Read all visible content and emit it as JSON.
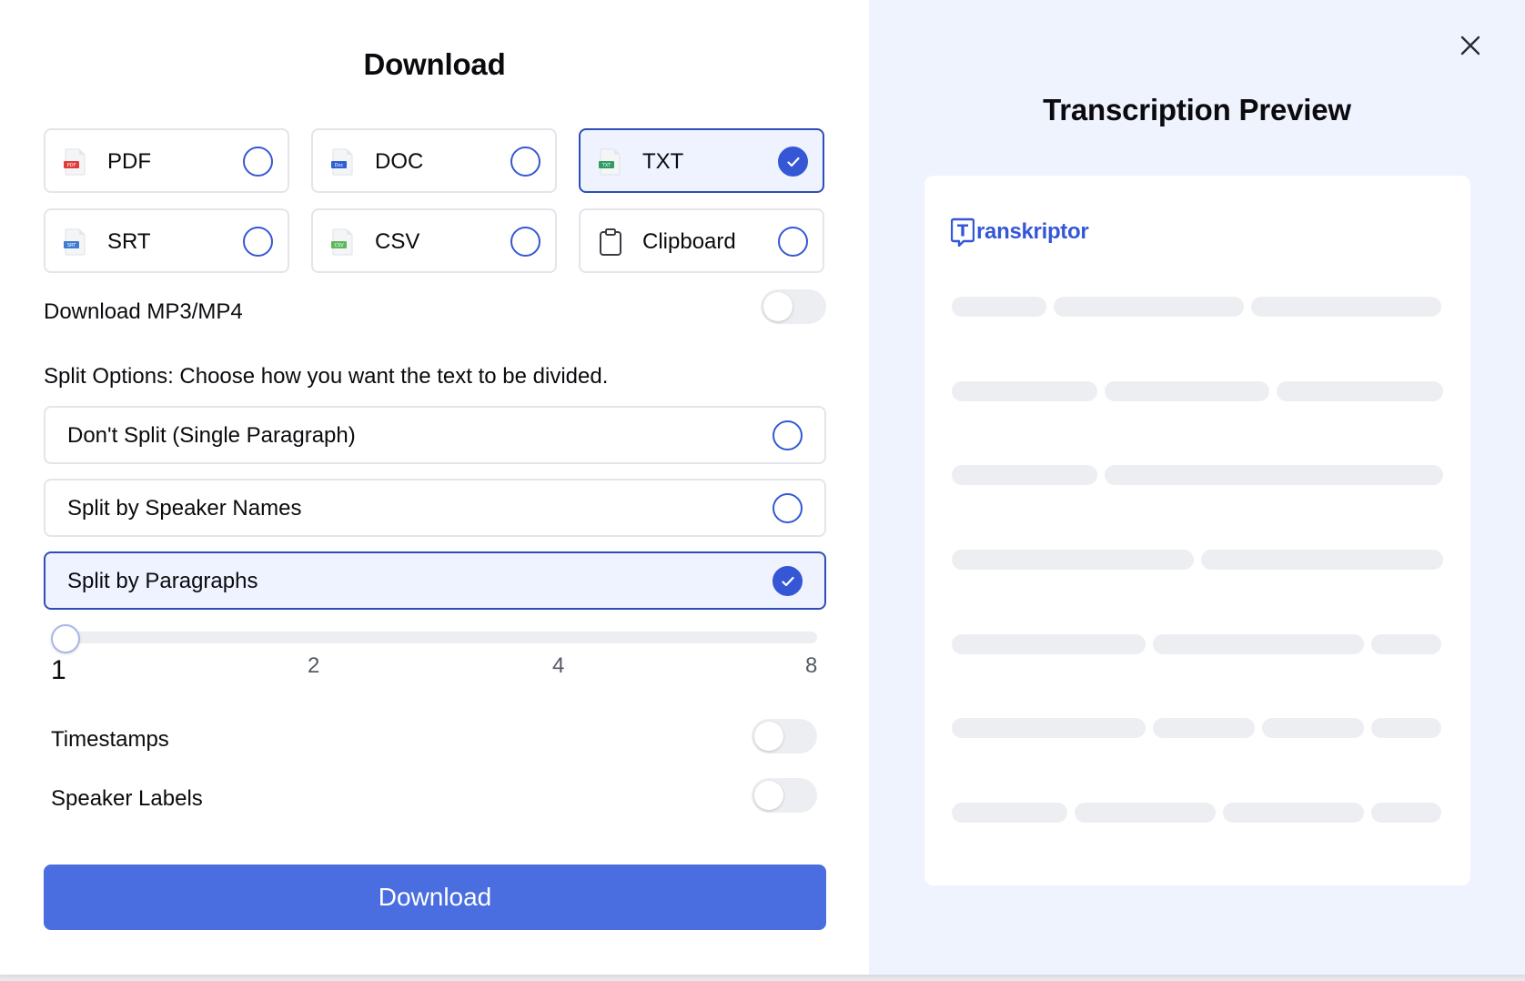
{
  "dialog": {
    "title": "Download",
    "close_icon": "close-icon"
  },
  "formats": [
    {
      "id": "pdf",
      "label": "PDF",
      "icon": "pdf-file-icon",
      "badge": "PDF",
      "color": "#e23b3b",
      "selected": false
    },
    {
      "id": "doc",
      "label": "DOC",
      "icon": "doc-file-icon",
      "badge": "Doc",
      "color": "#2f5fd0",
      "selected": false
    },
    {
      "id": "txt",
      "label": "TXT",
      "icon": "txt-file-icon",
      "badge": "TXT",
      "color": "#2f9d63",
      "selected": true
    },
    {
      "id": "srt",
      "label": "SRT",
      "icon": "srt-file-icon",
      "badge": "SRT",
      "color": "#3f7bd1",
      "selected": false
    },
    {
      "id": "csv",
      "label": "CSV",
      "icon": "csv-file-icon",
      "badge": "CSV",
      "color": "#5cb85c",
      "selected": false
    },
    {
      "id": "clipboard",
      "label": "Clipboard",
      "icon": "clipboard-icon",
      "selected": false
    }
  ],
  "media_download": {
    "label": "Download MP3/MP4",
    "enabled": false
  },
  "split": {
    "heading": "Split Options: Choose how you want the text to be divided.",
    "options": [
      {
        "label": "Don't Split (Single Paragraph)",
        "selected": false
      },
      {
        "label": "Split by Speaker Names",
        "selected": false
      },
      {
        "label": "Split by Paragraphs",
        "selected": true
      }
    ],
    "slider": {
      "ticks": [
        "1",
        "2",
        "4",
        "8"
      ],
      "value": "1"
    }
  },
  "options": {
    "timestamps": {
      "label": "Timestamps",
      "enabled": false
    },
    "speaker_labels": {
      "label": "Speaker Labels",
      "enabled": false
    }
  },
  "download_button": "Download",
  "preview": {
    "title": "Transcription Preview",
    "logo_text": "ranskriptor",
    "logo_letter": "T"
  },
  "colors": {
    "accent": "#3557d6",
    "button": "#4a6ee0",
    "preview_bg": "#eef3fd"
  }
}
